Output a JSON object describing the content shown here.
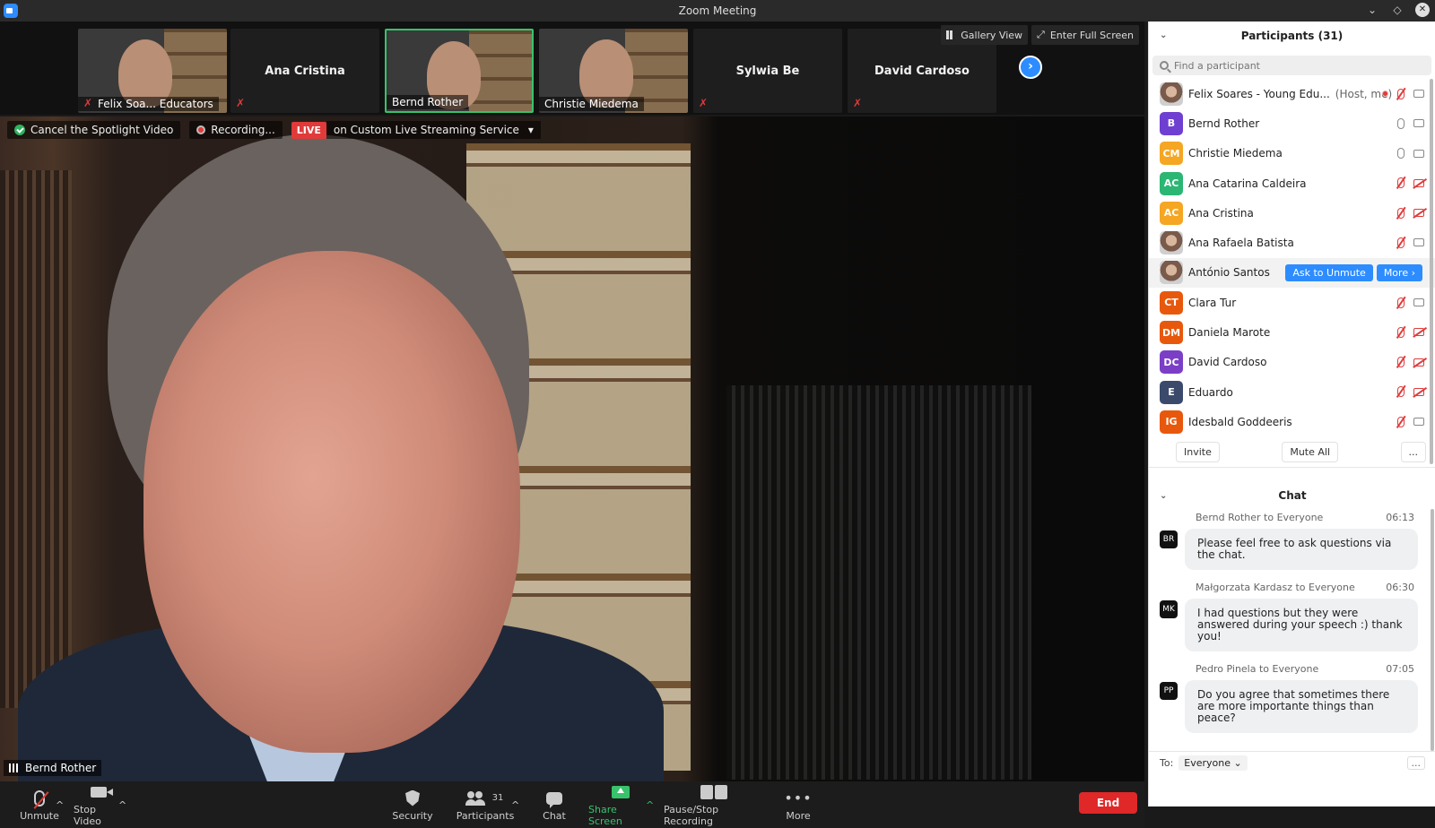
{
  "window": {
    "title": "Zoom Meeting"
  },
  "colors": {
    "accent": "#2d8cff",
    "live": "#e03a3a",
    "end": "#e02828",
    "active_border": "#37c36b"
  },
  "strip": {
    "tiles": [
      {
        "name": "",
        "label": "Felix Soa... Educators",
        "has_video": true,
        "muted": true
      },
      {
        "name": "Ana Cristina",
        "label": "",
        "has_video": false,
        "muted": true
      },
      {
        "name": "",
        "label": "Bernd Rother",
        "has_video": true,
        "muted": false,
        "active": true
      },
      {
        "name": "",
        "label": "Christie Miedema",
        "has_video": true,
        "muted": false
      },
      {
        "name": "Sylwia Be",
        "label": "",
        "has_video": false,
        "muted": true
      },
      {
        "name": "David Cardoso",
        "label": "",
        "has_video": false,
        "muted": true
      }
    ],
    "next_icon": "chevron-right-icon"
  },
  "view_buttons": {
    "gallery": "Gallery View",
    "fullscreen": "Enter Full Screen"
  },
  "status": {
    "spotlight": "Cancel the Spotlight Video",
    "recording": "Recording...",
    "live_badge": "LIVE",
    "live_service": "on Custom Live Streaming Service"
  },
  "spotlight": {
    "speaker": "Bernd Rother"
  },
  "toolbar": {
    "unmute": "Unmute",
    "stop_video": "Stop Video",
    "security": "Security",
    "participants": "Participants",
    "participants_count": "31",
    "chat": "Chat",
    "share_screen": "Share Screen",
    "pause_stop_recording": "Pause/Stop Recording",
    "more": "More",
    "end": "End"
  },
  "participants_panel": {
    "title": "Participants (31)",
    "search_placeholder": "Find a participant",
    "participants": [
      {
        "initials": "",
        "avatar_color": "photo",
        "name": "Felix Soares - Young Edu...",
        "role": "(Host, me)",
        "mic": "off",
        "cam": "on",
        "recording": true
      },
      {
        "initials": "B",
        "avatar_color": "#6e3fd0",
        "name": "Bernd Rother",
        "mic": "on",
        "cam": "on"
      },
      {
        "initials": "CM",
        "avatar_color": "#f5a623",
        "name": "Christie Miedema",
        "mic": "on",
        "cam": "on"
      },
      {
        "initials": "AC",
        "avatar_color": "#2bb673",
        "name": "Ana Catarina Caldeira",
        "mic": "off",
        "cam": "off"
      },
      {
        "initials": "AC",
        "avatar_color": "#f5a623",
        "name": "Ana Cristina",
        "mic": "off",
        "cam": "off"
      },
      {
        "initials": "",
        "avatar_color": "photo",
        "name": "Ana Rafaela Batista",
        "mic": "off",
        "cam": "on"
      },
      {
        "initials": "",
        "avatar_color": "photo",
        "name": "António Santos",
        "hover": true,
        "ask_to_unmute": "Ask to Unmute",
        "more": "More"
      },
      {
        "initials": "CT",
        "avatar_color": "#e8580c",
        "name": "Clara Tur",
        "mic": "off",
        "cam": "on"
      },
      {
        "initials": "DM",
        "avatar_color": "#e8580c",
        "name": "Daniela Marote",
        "mic": "off",
        "cam": "off"
      },
      {
        "initials": "DC",
        "avatar_color": "#7b3fc6",
        "name": "David Cardoso",
        "mic": "off",
        "cam": "off"
      },
      {
        "initials": "E",
        "avatar_color": "#3b4a6b",
        "name": "Eduardo",
        "mic": "off",
        "cam": "off"
      },
      {
        "initials": "IG",
        "avatar_color": "#e8580c",
        "name": "Idesbald Goddeeris",
        "mic": "off",
        "cam": "on"
      }
    ],
    "actions": {
      "invite": "Invite",
      "mute_all": "Mute All",
      "more": "..."
    }
  },
  "chat_panel": {
    "title": "Chat",
    "messages": [
      {
        "initials": "BR",
        "sender": "Bernd Rother to Everyone",
        "time": "06:13",
        "text": "Please feel free to ask questions via the chat."
      },
      {
        "initials": "MK",
        "sender": "Małgorzata Kardasz to Everyone",
        "time": "06:30",
        "text": "I had questions but they were answered during your speech :) thank you!"
      },
      {
        "initials": "PP",
        "sender": "Pedro Pinela to Everyone",
        "time": "07:05",
        "text": "Do you agree that sometimes there are more importante things than peace?"
      }
    ],
    "to_label": "To:",
    "to_value": "Everyone",
    "options": "..."
  }
}
